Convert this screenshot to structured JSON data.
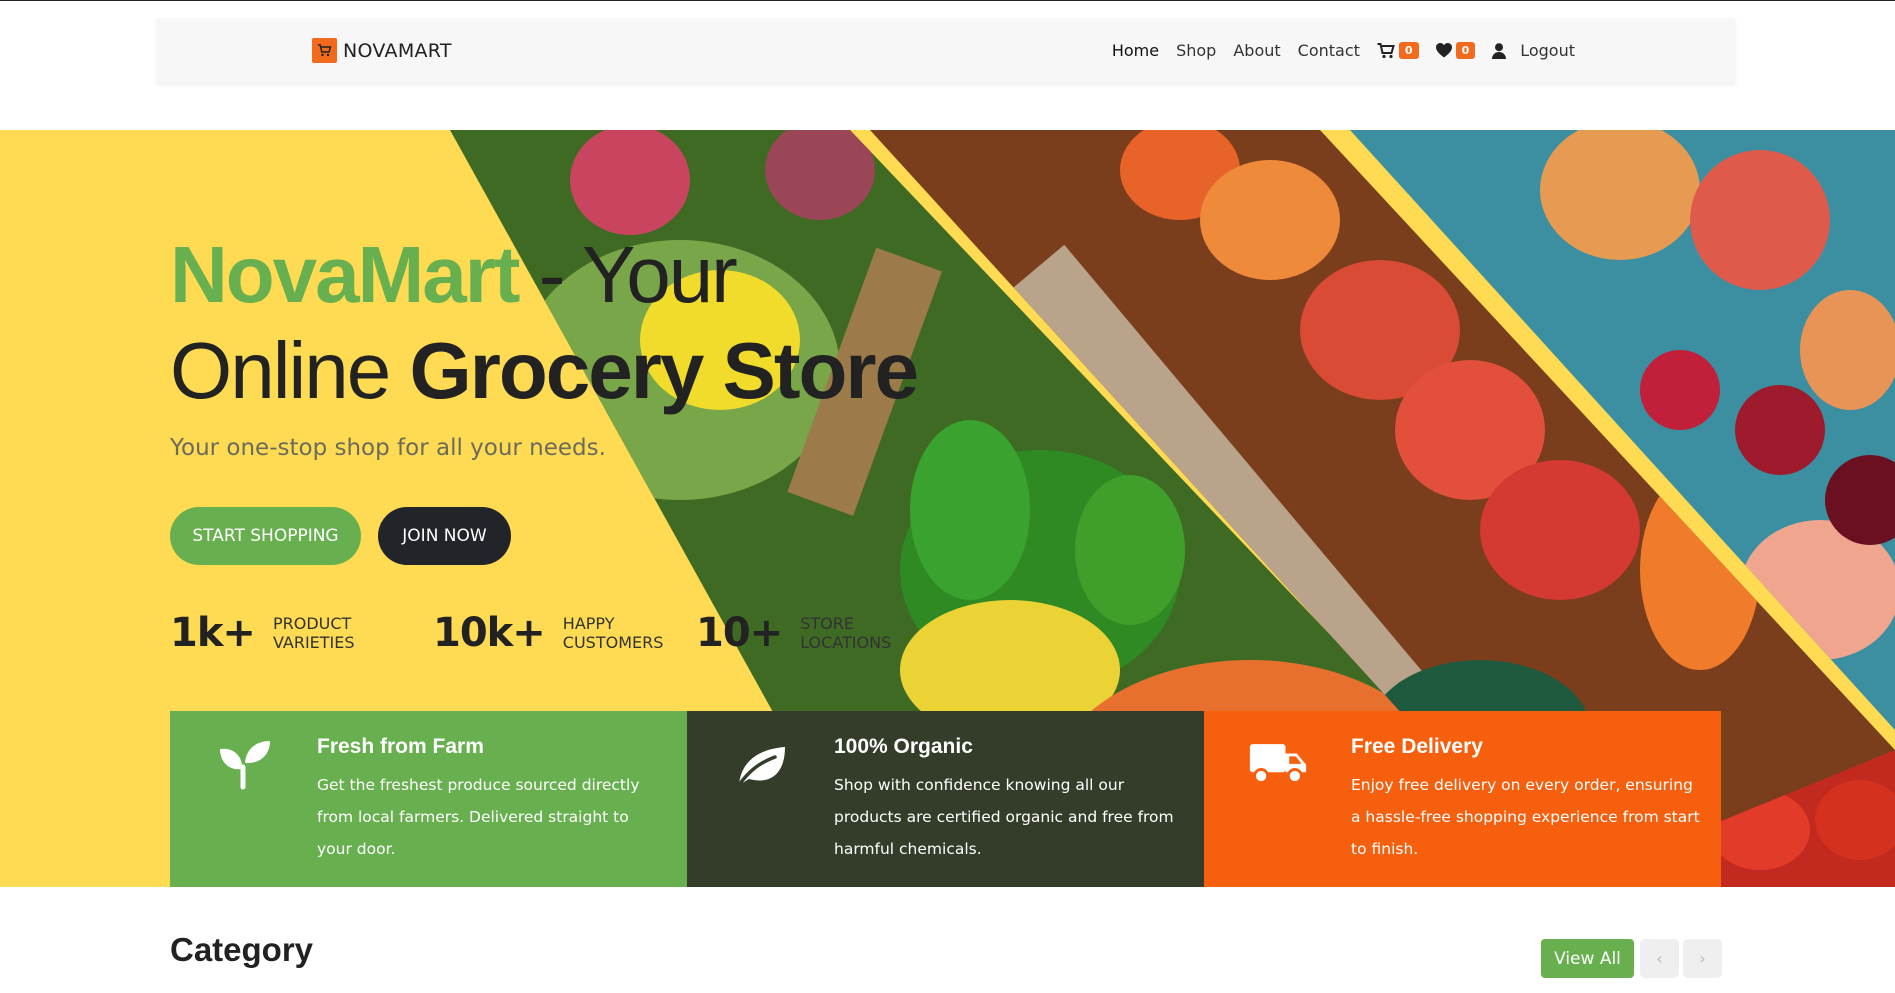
{
  "brand": {
    "name": "NOVAMART"
  },
  "nav": {
    "links": [
      "Home",
      "Shop",
      "About",
      "Contact"
    ],
    "cart_count": "0",
    "wishlist_count": "0",
    "logout": "Logout"
  },
  "hero": {
    "title_accent": "NovaMart",
    "title_rest": " - Your",
    "title_line2_normal": "Online ",
    "title_line2_bold": "Grocery Store",
    "subtitle": "Your one-stop shop for all your needs.",
    "btn_primary": "START SHOPPING",
    "btn_secondary": "JOIN NOW",
    "stats": [
      {
        "value": "1k+",
        "label": "PRODUCT VARIETIES"
      },
      {
        "value": "10k+",
        "label": "HAPPY CUSTOMERS"
      },
      {
        "value": "10+",
        "label": "STORE LOCATIONS"
      }
    ]
  },
  "features": [
    {
      "title": "Fresh from Farm",
      "text": "Get the freshest produce sourced directly from local farmers. Delivered straight to your door.",
      "icon": "sprout-icon"
    },
    {
      "title": "100% Organic",
      "text": "Shop with confidence knowing all our products are certified organic and free from harmful chemicals.",
      "icon": "leaf-icon"
    },
    {
      "title": "Free Delivery",
      "text": "Enjoy free delivery on every order, ensuring a hassle-free shopping experience from start to finish.",
      "icon": "truck-icon"
    }
  ],
  "category": {
    "title": "Category",
    "view_all": "View All",
    "prev": "‹",
    "next": "›"
  },
  "colors": {
    "accent_green": "#68b04f",
    "accent_orange": "#f55f0d",
    "hero_yellow": "#fedb52",
    "dark_olive": "#333d29"
  }
}
